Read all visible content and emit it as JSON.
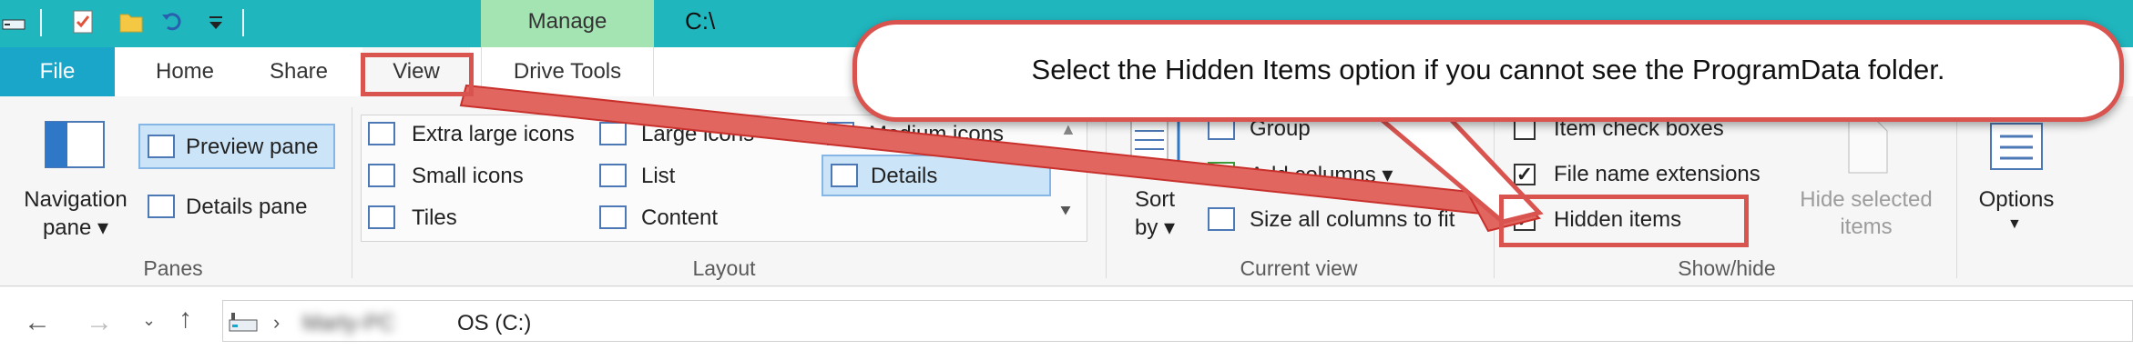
{
  "window": {
    "manage_tab": "Manage",
    "path_title": "C:\\"
  },
  "tabs": [
    {
      "label": "File"
    },
    {
      "label": "Home"
    },
    {
      "label": "Share"
    },
    {
      "label": "View"
    },
    {
      "label": "Drive Tools"
    }
  ],
  "panes": {
    "navigation_pane": "Navigation",
    "navigation_pane2": "pane",
    "preview_pane": "Preview pane",
    "details_pane": "Details pane",
    "group_label": "Panes"
  },
  "layout": {
    "items": [
      "Extra large icons",
      "Large icons",
      "Medium icons",
      "Small icons",
      "List",
      "Details",
      "Tiles",
      "Content"
    ],
    "selected": "Details",
    "group_label": "Layout"
  },
  "current_view": {
    "sort": "Sort",
    "by": "by",
    "group_by": "Group",
    "add_columns": "Add columns",
    "size_all": "Size all columns to fit",
    "group_label": "Current view"
  },
  "show_hide": {
    "item_check_boxes": {
      "label": "Item check boxes",
      "checked": false
    },
    "file_name_extensions": {
      "label": "File name extensions",
      "checked": true
    },
    "hidden_items": {
      "label": "Hidden items",
      "checked": true
    },
    "hide_selected_1": "Hide selected",
    "hide_selected_2": "items",
    "group_label": "Show/hide"
  },
  "options": {
    "label": "Options"
  },
  "address": {
    "pc_name": "Marty-PC",
    "drive": "OS (C:)"
  },
  "callout": {
    "text": "Select the Hidden Items option if you cannot see the ProgramData folder."
  },
  "colors": {
    "titlebar": "#20b6be",
    "file_tab": "#1aa6c9",
    "manage": "#a3e4b2",
    "annotation": "#d9534f"
  }
}
